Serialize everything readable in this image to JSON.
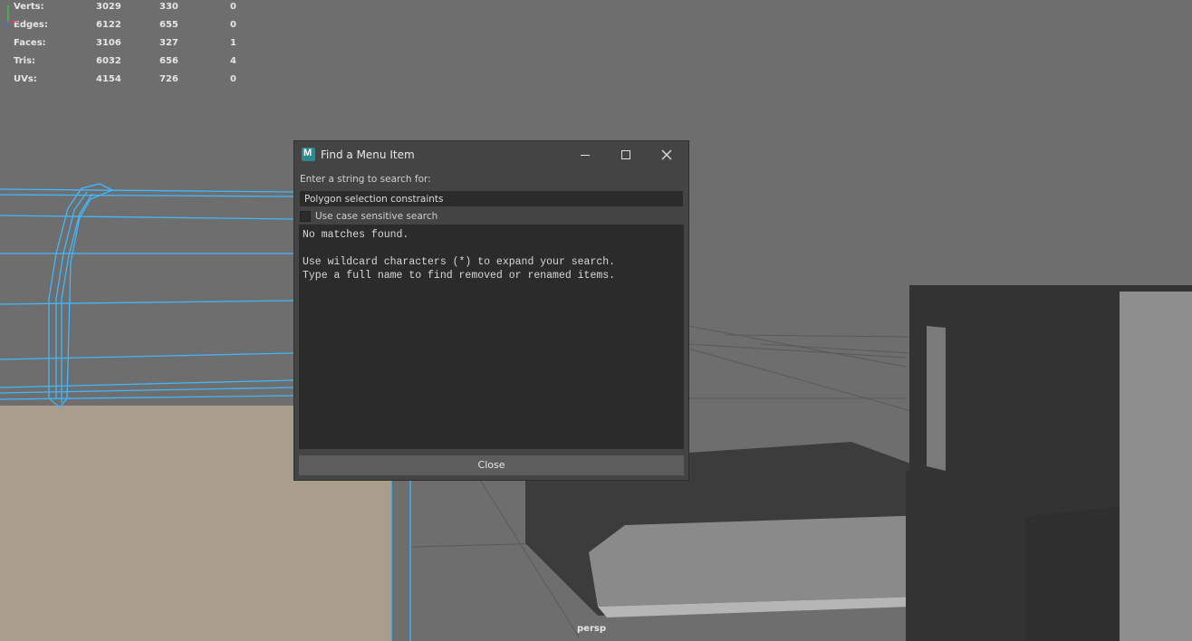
{
  "hud": {
    "rows": [
      {
        "label": "Verts:",
        "a": "3029",
        "b": "330",
        "c": "0"
      },
      {
        "label": "Edges:",
        "a": "6122",
        "b": "655",
        "c": "0"
      },
      {
        "label": "Faces:",
        "a": "3106",
        "b": "327",
        "c": "1"
      },
      {
        "label": "Tris:",
        "a": "6032",
        "b": "656",
        "c": "4"
      },
      {
        "label": "UVs:",
        "a": "4154",
        "b": "726",
        "c": "0"
      }
    ]
  },
  "viewport": {
    "camera_label": "persp",
    "colors": {
      "background": "#6e6e6e",
      "wire": "#4fc3ff",
      "floor": "#a89c8a",
      "dark_mesh": "#3e3e3e",
      "light_mesh": "#8c8c8c"
    }
  },
  "dialog": {
    "title": "Find a Menu Item",
    "icons": {
      "app": "maya-app-icon",
      "minimize": "minimize-icon",
      "maximize": "maximize-icon",
      "close": "close-icon"
    },
    "prompt": "Enter a string to search for:",
    "search_value": "Polygon selection constraints",
    "case_checkbox_label": "Use case sensitive search",
    "case_checked": false,
    "results": [
      "No matches found.",
      "",
      "Use wildcard characters (*) to expand your search.",
      "Type a full name to find removed or renamed items."
    ],
    "close_label": "Close"
  }
}
